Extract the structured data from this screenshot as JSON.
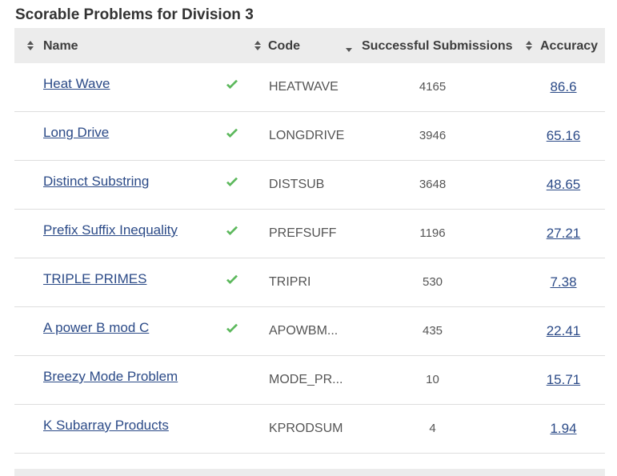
{
  "title": "Scorable Problems for Division 3",
  "columns": {
    "name": "Name",
    "code": "Code",
    "submissions": "Successful Submissions",
    "accuracy": "Accuracy"
  },
  "colors": {
    "link": "#2b4a87",
    "check": "#5cb85c",
    "header_bg": "#ececec"
  },
  "problems": [
    {
      "name": "Heat Wave",
      "solved": true,
      "code": "HEATWAVE",
      "submissions": "4165",
      "accuracy": "86.6"
    },
    {
      "name": "Long Drive",
      "solved": true,
      "code": "LONGDRIVE",
      "submissions": "3946",
      "accuracy": "65.16"
    },
    {
      "name": "Distinct Substring",
      "solved": true,
      "code": "DISTSUB",
      "submissions": "3648",
      "accuracy": "48.65"
    },
    {
      "name": "Prefix Suffix Inequality",
      "solved": true,
      "code": "PREFSUFF",
      "submissions": "1196",
      "accuracy": "27.21"
    },
    {
      "name": "TRIPLE PRIMES",
      "solved": true,
      "code": "TRIPRI",
      "submissions": "530",
      "accuracy": "7.38"
    },
    {
      "name": "A power B mod C",
      "solved": true,
      "code": "APOWBM...",
      "submissions": "435",
      "accuracy": "22.41"
    },
    {
      "name": "Breezy Mode Problem",
      "solved": false,
      "code": "MODE_PR...",
      "submissions": "10",
      "accuracy": "15.71"
    },
    {
      "name": "K Subarray Products",
      "solved": false,
      "code": "KPRODSUM",
      "submissions": "4",
      "accuracy": "1.94"
    }
  ]
}
